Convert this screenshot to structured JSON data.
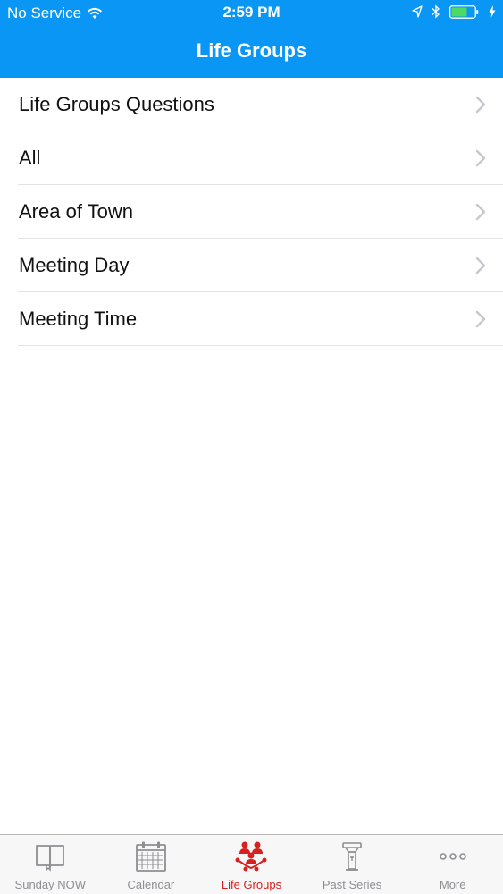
{
  "status_bar": {
    "carrier": "No Service",
    "time": "2:59 PM"
  },
  "nav": {
    "title": "Life Groups"
  },
  "list": {
    "items": [
      {
        "label": "Life Groups Questions"
      },
      {
        "label": "All"
      },
      {
        "label": "Area of Town"
      },
      {
        "label": "Meeting Day"
      },
      {
        "label": "Meeting Time"
      }
    ]
  },
  "tabbar": {
    "tabs": [
      {
        "label": "Sunday NOW",
        "icon": "book-icon"
      },
      {
        "label": "Calendar",
        "icon": "calendar-icon"
      },
      {
        "label": "Life Groups",
        "icon": "people-group-icon",
        "active": true
      },
      {
        "label": "Past Series",
        "icon": "podium-icon"
      },
      {
        "label": "More",
        "icon": "more-dots-icon"
      }
    ]
  },
  "colors": {
    "nav_background": "#0a96f4",
    "active_tab": "#d6211f",
    "inactive_tab": "#8e8e93",
    "battery": "#4cd964"
  }
}
